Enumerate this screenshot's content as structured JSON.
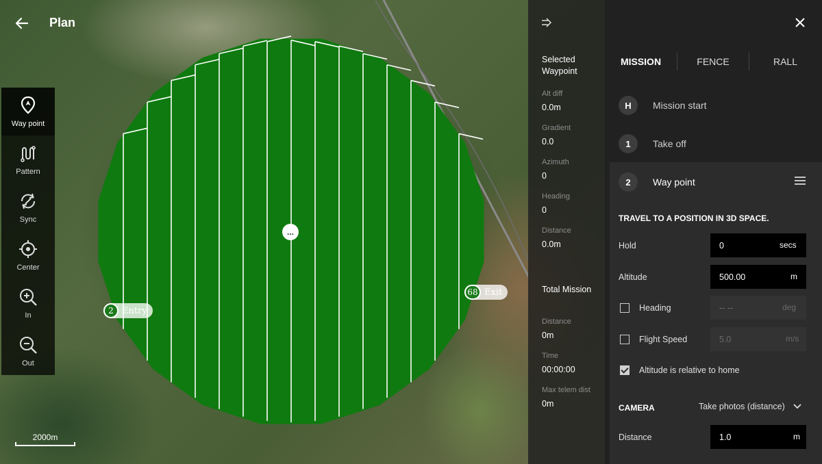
{
  "header": {
    "title": "Plan"
  },
  "toolbar": {
    "items": [
      {
        "label": "Way point",
        "icon": "waypoint-pin-icon",
        "active": true
      },
      {
        "label": "Pattern",
        "icon": "pattern-icon",
        "active": false
      },
      {
        "label": "Sync",
        "icon": "sync-icon",
        "active": false
      },
      {
        "label": "Center",
        "icon": "crosshair-icon",
        "active": false
      },
      {
        "label": "In",
        "icon": "zoom-in-icon",
        "active": false
      },
      {
        "label": "Out",
        "icon": "zoom-out-icon",
        "active": false
      }
    ]
  },
  "map": {
    "scale_label": "2000m",
    "entry_marker": {
      "number": "2",
      "label": "Entry"
    },
    "exit_marker": {
      "number": "68",
      "label": "Exit"
    },
    "center_handle": "...",
    "survey_color": "#0f7a0f",
    "transect_color": "#ffffff"
  },
  "waypoint_info": {
    "selected_heading": "Selected Waypoint",
    "alt_diff_label": "Alt diff",
    "alt_diff_value": "0.0m",
    "gradient_label": "Gradient",
    "gradient_value": "0.0",
    "azimuth_label": "Azimuth",
    "azimuth_value": "0",
    "heading_label": "Heading",
    "heading_value": "0",
    "distance_label": "Distance",
    "distance_value": "0.0m",
    "total_heading": "Total Mission",
    "total_distance_label": "Distance",
    "total_distance_value": "0m",
    "time_label": "Time",
    "time_value": "00:00:00",
    "max_telem_label": "Max telem dist",
    "max_telem_value": "0m"
  },
  "panel": {
    "tabs": [
      "MISSION",
      "FENCE",
      "RALL"
    ],
    "active_tab": "MISSION",
    "items": [
      {
        "badge": "H",
        "label": "Mission start"
      },
      {
        "badge": "1",
        "label": "Take off"
      }
    ],
    "waypoint": {
      "badge": "2",
      "label": "Way point",
      "description": "TRAVEL TO A POSITION IN 3D SPACE.",
      "hold_label": "Hold",
      "hold_value": "0",
      "hold_unit": "secs",
      "altitude_label": "Altitude",
      "altitude_value": "500.00",
      "altitude_unit": "m",
      "heading_label": "Heading",
      "heading_placeholder": "-- --",
      "heading_unit": "deg",
      "heading_checked": false,
      "flight_speed_label": "Flight Speed",
      "flight_speed_value": "5.0",
      "flight_speed_unit": "m/s",
      "flight_speed_checked": false,
      "altitude_relative_label": "Altitude is relative to home",
      "altitude_relative_checked": true,
      "camera_label": "CAMERA",
      "camera_mode": "Take photos (distance)",
      "distance_label": "Distance",
      "distance_value": "1.0",
      "distance_unit": "m"
    }
  }
}
